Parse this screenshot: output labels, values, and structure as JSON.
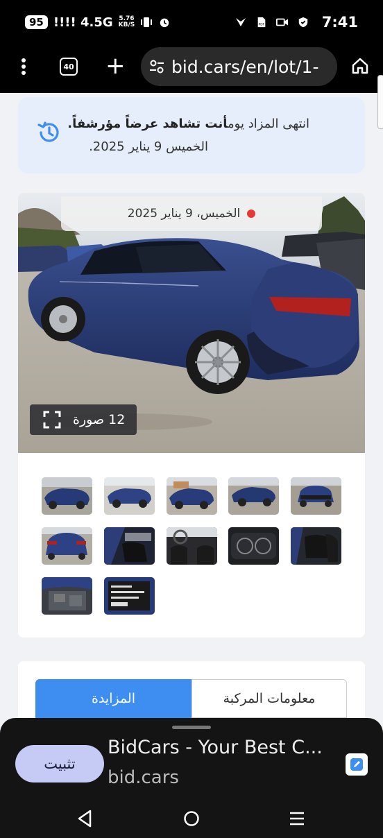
{
  "status_bar": {
    "battery": "95",
    "signal": "!!!! 4.5G",
    "speed_value": "5.76",
    "speed_unit": "KB/S",
    "time": "7:41"
  },
  "browser": {
    "tab_count": "40",
    "url": "bid.cars/en/lot/1-"
  },
  "notice": {
    "line1_prefix": "انتهى المزاد يوم",
    "line1_bold": "أنت تشاهد عرضاً مؤرشفاً.",
    "line2": "الخميس 9 يناير 2025."
  },
  "gallery": {
    "date_label": "الخميس، 9 يناير 2025",
    "photo_count_label": "12 صورة",
    "thumbnail_count": 12
  },
  "tabs": {
    "auction": "المزايدة",
    "vehicle_info": "معلومات المركبة"
  },
  "install_sheet": {
    "button": "تثبيت",
    "title": "BidCars - Your Best C...",
    "domain": "bid.cars"
  },
  "colors": {
    "accent_blue": "#3d8ef0",
    "notice_bg": "#e5eefa",
    "install_button_bg": "#c6cbf6",
    "live_dot": "#e53935"
  }
}
